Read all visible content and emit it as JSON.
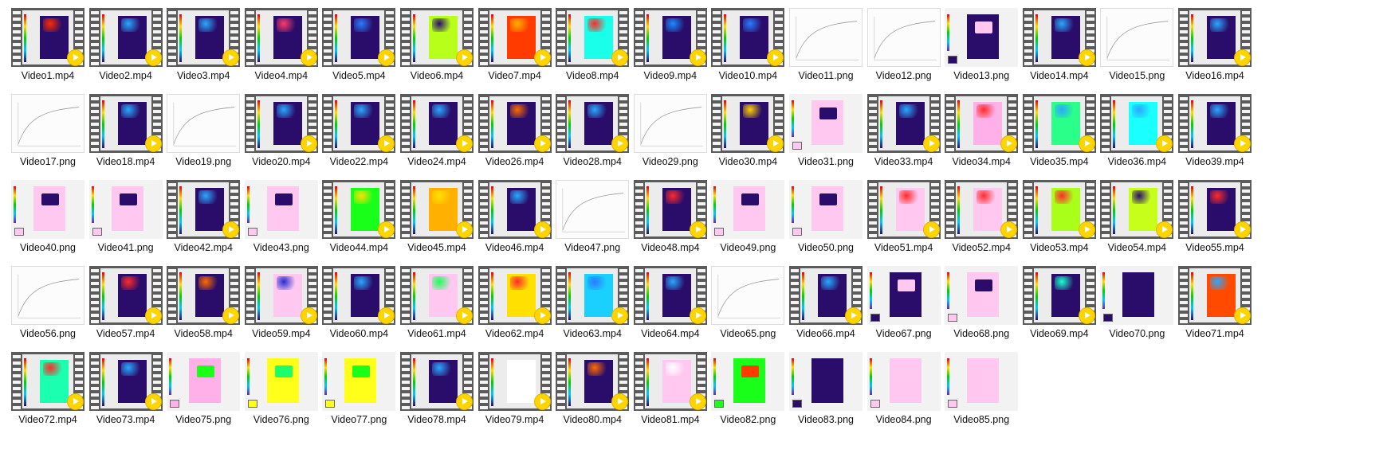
{
  "folder_view": {
    "items": [
      {
        "name": "Video1.mp4",
        "kind": "video",
        "bg": "#2a0d6a",
        "accent": "#ff2a00"
      },
      {
        "name": "Video2.mp4",
        "kind": "video",
        "bg": "#2a0d6a",
        "accent": "#2aa8ff"
      },
      {
        "name": "Video3.mp4",
        "kind": "video",
        "bg": "#2a0d6a",
        "accent": "#2aa8ff"
      },
      {
        "name": "Video4.mp4",
        "kind": "video",
        "bg": "#2a0d6a",
        "accent": "#ff3b6b"
      },
      {
        "name": "Video5.mp4",
        "kind": "video",
        "bg": "#2a0d6a",
        "accent": "#2a7bff"
      },
      {
        "name": "Video6.mp4",
        "kind": "video",
        "bg": "#b8ff1a",
        "accent": "#2a0d6a"
      },
      {
        "name": "Video7.mp4",
        "kind": "video",
        "bg": "#ff3b00",
        "accent": "#ffb000"
      },
      {
        "name": "Video8.mp4",
        "kind": "video",
        "bg": "#1affea",
        "accent": "#ff2a2a"
      },
      {
        "name": "Video9.mp4",
        "kind": "video",
        "bg": "#2a0d6a",
        "accent": "#1a8bff"
      },
      {
        "name": "Video10.mp4",
        "kind": "video",
        "bg": "#2a0d6a",
        "accent": "#2a7bff"
      },
      {
        "name": "Video11.png",
        "kind": "line"
      },
      {
        "name": "Video12.png",
        "kind": "line"
      },
      {
        "name": "Video13.png",
        "kind": "plot",
        "bg": "#2a0d6a",
        "accent": "#ffc8f0"
      },
      {
        "name": "Video14.mp4",
        "kind": "video",
        "bg": "#2a0d6a",
        "accent": "#2aa8ff"
      },
      {
        "name": "Video15.png",
        "kind": "line"
      },
      {
        "name": "Video16.mp4",
        "kind": "video",
        "bg": "#2a0d6a",
        "accent": "#2aa8ff"
      },
      {
        "name": "Video17.png",
        "kind": "line"
      },
      {
        "name": "Video18.mp4",
        "kind": "video",
        "bg": "#2a0d6a",
        "accent": "#2aa8ff"
      },
      {
        "name": "Video19.png",
        "kind": "line"
      },
      {
        "name": "Video20.mp4",
        "kind": "video",
        "bg": "#2a0d6a",
        "accent": "#2aa8ff"
      },
      {
        "name": "Video22.mp4",
        "kind": "video",
        "bg": "#2a0d6a",
        "accent": "#2aa8ff"
      },
      {
        "name": "Video24.mp4",
        "kind": "video",
        "bg": "#2a0d6a",
        "accent": "#2aa8ff"
      },
      {
        "name": "Video26.mp4",
        "kind": "video",
        "bg": "#2a0d6a",
        "accent": "#ff6a00"
      },
      {
        "name": "Video28.mp4",
        "kind": "video",
        "bg": "#2a0d6a",
        "accent": "#2aa8ff"
      },
      {
        "name": "Video29.png",
        "kind": "line"
      },
      {
        "name": "Video30.mp4",
        "kind": "video",
        "bg": "#2a0d6a",
        "accent": "#ffd000"
      },
      {
        "name": "Video31.png",
        "kind": "plot",
        "bg": "#ffc8f0",
        "accent": "#2a0d6a"
      },
      {
        "name": "Video33.mp4",
        "kind": "video",
        "bg": "#2a0d6a",
        "accent": "#2aa8ff"
      },
      {
        "name": "Video34.mp4",
        "kind": "video",
        "bg": "#ffb0e8",
        "accent": "#ff2a2a"
      },
      {
        "name": "Video35.mp4",
        "kind": "video",
        "bg": "#2aff8a",
        "accent": "#2aa8ff"
      },
      {
        "name": "Video36.mp4",
        "kind": "video",
        "bg": "#1affff",
        "accent": "#2aa8ff"
      },
      {
        "name": "Video39.mp4",
        "kind": "video",
        "bg": "#2a0d6a",
        "accent": "#2aa8ff"
      },
      {
        "name": "Video40.png",
        "kind": "plot",
        "bg": "#ffc8f0",
        "accent": "#2a0d6a"
      },
      {
        "name": "Video41.png",
        "kind": "plot",
        "bg": "#ffc8f0",
        "accent": "#2a0d6a"
      },
      {
        "name": "Video42.mp4",
        "kind": "video",
        "bg": "#2a0d6a",
        "accent": "#2aa8ff"
      },
      {
        "name": "Video43.png",
        "kind": "plot",
        "bg": "#ffc8f0",
        "accent": "#2a0d6a"
      },
      {
        "name": "Video44.mp4",
        "kind": "video",
        "bg": "#1aff1a",
        "accent": "#ffe000"
      },
      {
        "name": "Video45.mp4",
        "kind": "video",
        "bg": "#ffb000",
        "accent": "#ffe000"
      },
      {
        "name": "Video46.mp4",
        "kind": "video",
        "bg": "#2a0d6a",
        "accent": "#2aa8ff"
      },
      {
        "name": "Video47.png",
        "kind": "line"
      },
      {
        "name": "Video48.mp4",
        "kind": "video",
        "bg": "#2a0d6a",
        "accent": "#ff2a2a"
      },
      {
        "name": "Video49.png",
        "kind": "plot",
        "bg": "#ffc8f0",
        "accent": "#2a0d6a"
      },
      {
        "name": "Video50.png",
        "kind": "plot",
        "bg": "#ffc8f0",
        "accent": "#2a0d6a"
      },
      {
        "name": "Video51.mp4",
        "kind": "video",
        "bg": "#ffc8f0",
        "accent": "#ff2a2a"
      },
      {
        "name": "Video52.mp4",
        "kind": "video",
        "bg": "#ffc8f0",
        "accent": "#ff2a2a"
      },
      {
        "name": "Video53.mp4",
        "kind": "video",
        "bg": "#aaff1a",
        "accent": "#ff2a2a"
      },
      {
        "name": "Video54.mp4",
        "kind": "video",
        "bg": "#c8ff1a",
        "accent": "#2a0d6a"
      },
      {
        "name": "Video55.mp4",
        "kind": "video",
        "bg": "#2a0d6a",
        "accent": "#ff2a2a"
      },
      {
        "name": "Video56.png",
        "kind": "line"
      },
      {
        "name": "Video57.mp4",
        "kind": "video",
        "bg": "#2a0d6a",
        "accent": "#ff2a2a"
      },
      {
        "name": "Video58.mp4",
        "kind": "video",
        "bg": "#2a0d6a",
        "accent": "#ff6a00"
      },
      {
        "name": "Video59.mp4",
        "kind": "video",
        "bg": "#ffc8f0",
        "accent": "#2a2ad0"
      },
      {
        "name": "Video60.mp4",
        "kind": "video",
        "bg": "#2a0d6a",
        "accent": "#2aa8ff"
      },
      {
        "name": "Video61.mp4",
        "kind": "video",
        "bg": "#ffc8f0",
        "accent": "#1aff5a"
      },
      {
        "name": "Video62.mp4",
        "kind": "video",
        "bg": "#ffe000",
        "accent": "#ff2a2a"
      },
      {
        "name": "Video63.mp4",
        "kind": "video",
        "bg": "#1ad0ff",
        "accent": "#2a7bff"
      },
      {
        "name": "Video64.mp4",
        "kind": "video",
        "bg": "#2a0d6a",
        "accent": "#2aa8ff"
      },
      {
        "name": "Video65.png",
        "kind": "line"
      },
      {
        "name": "Video66.mp4",
        "kind": "video",
        "bg": "#2a0d6a",
        "accent": "#2aa8ff"
      },
      {
        "name": "Video67.png",
        "kind": "plot",
        "bg": "#2a0d6a",
        "accent": "#ffc8f0"
      },
      {
        "name": "Video68.png",
        "kind": "plot",
        "bg": "#ffc8f0",
        "accent": "#2a0d6a"
      },
      {
        "name": "Video69.mp4",
        "kind": "video",
        "bg": "#2a0d6a",
        "accent": "#1affd0"
      },
      {
        "name": "Video70.png",
        "kind": "plot",
        "bg": "#2a0d6a",
        "accent": "#2a0d6a"
      },
      {
        "name": "Video71.mp4",
        "kind": "video",
        "bg": "#ff4a00",
        "accent": "#2aa8ff"
      },
      {
        "name": "Video72.mp4",
        "kind": "video",
        "bg": "#1affb0",
        "accent": "#ff2a2a"
      },
      {
        "name": "Video73.mp4",
        "kind": "video",
        "bg": "#2a0d6a",
        "accent": "#2aa8ff"
      },
      {
        "name": "Video75.png",
        "kind": "plot",
        "bg": "#ffb0e8",
        "accent": "#1aff1a"
      },
      {
        "name": "Video76.png",
        "kind": "plot",
        "bg": "#ffff1a",
        "accent": "#1aff6a"
      },
      {
        "name": "Video77.png",
        "kind": "plot",
        "bg": "#ffff1a",
        "accent": "#1aff1a"
      },
      {
        "name": "Video78.mp4",
        "kind": "video",
        "bg": "#2a0d6a",
        "accent": "#2aa8ff"
      },
      {
        "name": "Video79.mp4",
        "kind": "video",
        "bg": "#ffffff",
        "accent": "#ffffff"
      },
      {
        "name": "Video80.mp4",
        "kind": "video",
        "bg": "#2a0d6a",
        "accent": "#ff6a00"
      },
      {
        "name": "Video81.mp4",
        "kind": "video",
        "bg": "#ffc8f0",
        "accent": "#ffffff"
      },
      {
        "name": "Video82.png",
        "kind": "plot",
        "bg": "#1aff1a",
        "accent": "#ff3b00"
      },
      {
        "name": "Video83.png",
        "kind": "plot",
        "bg": "#2a0d6a",
        "accent": "#2a0d6a"
      },
      {
        "name": "Video84.png",
        "kind": "plot",
        "bg": "#ffc8f0",
        "accent": "#ffc8f0"
      },
      {
        "name": "Video85.png",
        "kind": "plot",
        "bg": "#ffc8f0",
        "accent": "#ffc8f0"
      }
    ]
  }
}
